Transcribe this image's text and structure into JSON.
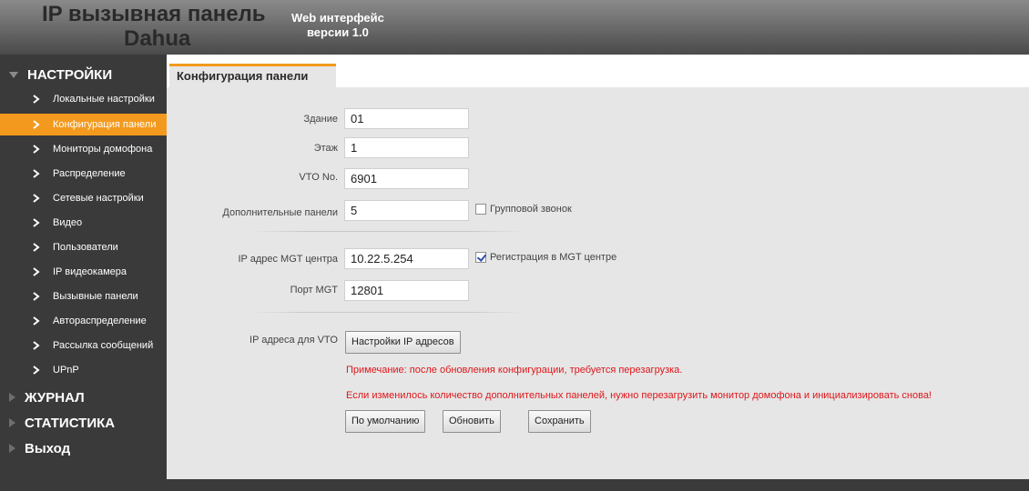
{
  "header": {
    "title_line1": "IP вызывная панель",
    "title_line2": "Dahua",
    "subtitle_line1": "Web интерфейс",
    "subtitle_line2": "версии 1.0"
  },
  "sidebar": {
    "settings_section": "НАСТРОЙКИ",
    "items": [
      {
        "label": "Локальные настройки"
      },
      {
        "label": "Конфигурация панели"
      },
      {
        "label": "Мониторы домофона"
      },
      {
        "label": "Распределение"
      },
      {
        "label": "Сетевые настройки"
      },
      {
        "label": "Видео"
      },
      {
        "label": "Пользователи"
      },
      {
        "label": "IP видеокамера"
      },
      {
        "label": "Вызывные панели"
      },
      {
        "label": "Автораспределение"
      },
      {
        "label": "Рассылка сообщений"
      },
      {
        "label": "UPnP"
      }
    ],
    "log_section": "ЖУРНАЛ",
    "stats_section": "СТАТИСТИКА",
    "exit_section": "Выход",
    "active_color": "#f39a1e"
  },
  "tab": {
    "label": "Конфигурация панели"
  },
  "form": {
    "building_label": "Здание",
    "building_value": "01",
    "floor_label": "Этаж",
    "floor_value": "1",
    "vto_label": "VTO No.",
    "vto_value": "6901",
    "extra_panels_label": "Дополнительные панели",
    "extra_panels_value": "5",
    "group_call_label": "Групповой звонок",
    "group_call_checked": false,
    "mgt_ip_label": "IP адрес MGT центра",
    "mgt_ip_value": "10.22.5.254",
    "mgt_register_label": "Регистрация в MGT центре",
    "mgt_register_checked": true,
    "mgt_port_label": "Порт MGT",
    "mgt_port_value": "12801",
    "vto_ip_label": "IP адреса для VTO",
    "ip_settings_button": "Настройки IP адресов",
    "note1": "Примечание: после обновления конфигурации, требуется перезагрузка.",
    "note2": "Если изменилось количество дополнительных панелей, нужно перезагрузить монитор домофона и инициализировать снова!",
    "default_button": "По умолчанию",
    "refresh_button": "Обновить",
    "save_button": "Сохранить"
  }
}
